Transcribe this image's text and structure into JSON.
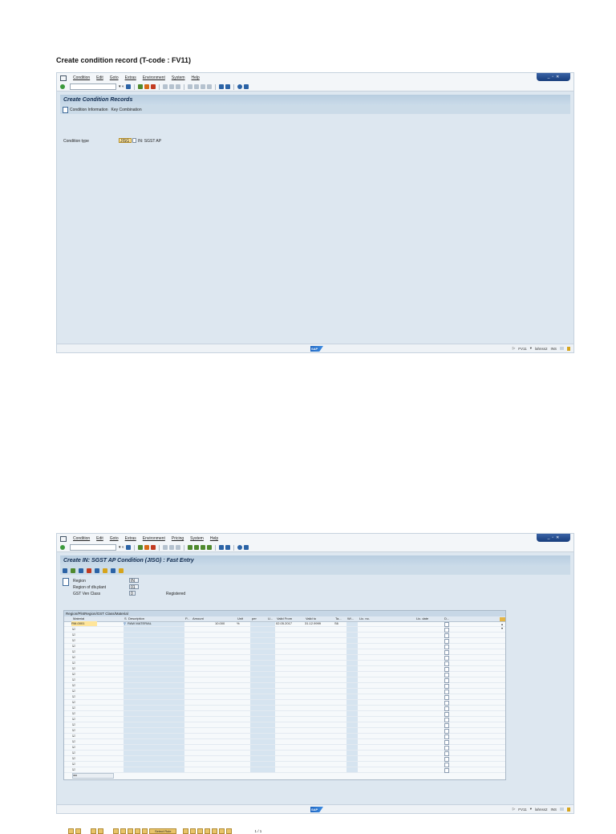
{
  "caption": "Create condition record (T-code : FV11)",
  "window1": {
    "menu": [
      "Condition",
      "Edit",
      "Goto",
      "Extras",
      "Environment",
      "System",
      "Help"
    ],
    "title": "Create Condition Records",
    "app_toolbar": {
      "condition_information": "Condition Information",
      "key_combination": "Key Combination"
    },
    "condition_type_label": "Condition type",
    "condition_type_value": "JISG",
    "condition_type_desc": "IN: SGST AP"
  },
  "window2": {
    "menu": [
      "Condition",
      "Edit",
      "Goto",
      "Extras",
      "Environment",
      "Pricing",
      "System",
      "Help"
    ],
    "title": "Create IN: SGST AP Condition (JISG) : Fast Entry",
    "header": {
      "region_label": "Region",
      "region_value": "IN",
      "region_plant_label": "Region of dlv.plant",
      "region_plant_value": "01",
      "gst_vendor_label": "GST Ven Class",
      "gst_vendor_value": "0",
      "gst_vendor_text": "Registered"
    },
    "table_title": "Region/PlntRegion/GST Class/Material",
    "columns": [
      "Material",
      "S",
      "Description",
      "P...",
      "Amount",
      "Unit",
      "per",
      "U...",
      "Valid From",
      "Valid to",
      "Ta...",
      "W/...",
      "Lic. no.",
      "Lic. date",
      "D..."
    ],
    "row1": {
      "material": "RM-0001",
      "description": "RAW MATERIAL",
      "amount": "10.000",
      "unit": "%",
      "valid_from": "02.05.2017",
      "valid_to": "31.12.9999",
      "tax": "S6"
    },
    "select_rule_label": "Select Rule",
    "page_indicator": "1 / 1"
  },
  "status": {
    "tcode": "FV11",
    "server": "lahnss2",
    "mode": "INS",
    "logo": "SAP"
  }
}
